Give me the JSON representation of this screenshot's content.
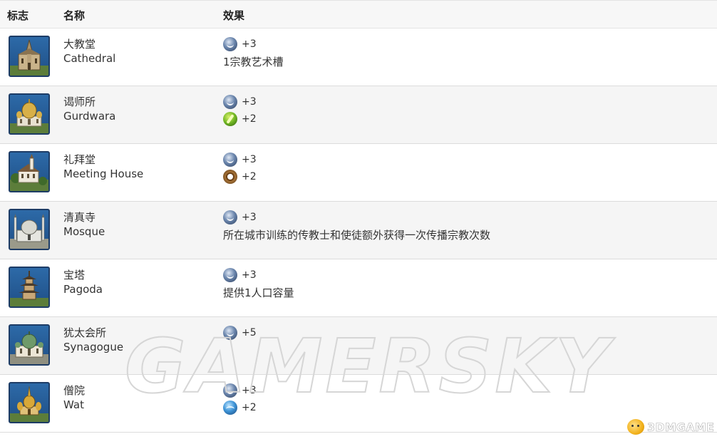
{
  "header": {
    "col_icon": "标志",
    "col_name": "名称",
    "col_effect": "效果"
  },
  "rows": [
    {
      "name_zh": "大教堂",
      "name_en": "Cathedral",
      "icon": "cathedral-icon",
      "effects": [
        {
          "yield": "faith",
          "value": "+3"
        }
      ],
      "note": "1宗教艺术槽"
    },
    {
      "name_zh": "谒师所",
      "name_en": "Gurdwara",
      "icon": "gurdwara-icon",
      "effects": [
        {
          "yield": "faith",
          "value": "+3"
        },
        {
          "yield": "food",
          "value": "+2"
        }
      ]
    },
    {
      "name_zh": "礼拜堂",
      "name_en": "Meeting House",
      "icon": "meeting-house-icon",
      "effects": [
        {
          "yield": "faith",
          "value": "+3"
        },
        {
          "yield": "production",
          "value": "+2"
        }
      ]
    },
    {
      "name_zh": "清真寺",
      "name_en": "Mosque",
      "icon": "mosque-icon",
      "effects": [
        {
          "yield": "faith",
          "value": "+3"
        }
      ],
      "note": "所在城市训练的传教士和使徒额外获得一次传播宗教次数"
    },
    {
      "name_zh": "宝塔",
      "name_en": "Pagoda",
      "icon": "pagoda-icon",
      "effects": [
        {
          "yield": "faith",
          "value": "+3"
        }
      ],
      "note": "提供1人口容量"
    },
    {
      "name_zh": "犹太会所",
      "name_en": "Synagogue",
      "icon": "synagogue-icon",
      "effects": [
        {
          "yield": "faith",
          "value": "+5"
        }
      ]
    },
    {
      "name_zh": "僧院",
      "name_en": "Wat",
      "icon": "wat-icon",
      "effects": [
        {
          "yield": "faith",
          "value": "+3"
        },
        {
          "yield": "science",
          "value": "+2"
        }
      ]
    }
  ],
  "watermark": "GAMERSKY",
  "logo": "3DMGAME",
  "colors": {
    "header_bg": "#f7f7f7",
    "alt_row_bg": "#f5f5f5",
    "icon_frame": "#1f4f86"
  }
}
